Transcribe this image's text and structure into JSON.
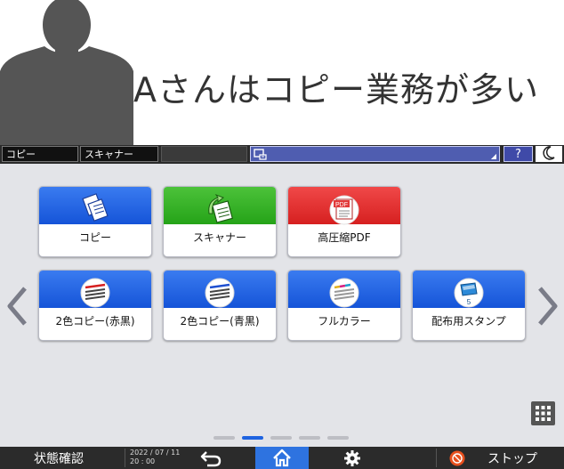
{
  "banner": {
    "headline": "Aさんはコピー業務が多い"
  },
  "topbar": {
    "tab1": "コピー",
    "tab2": "スキャナー",
    "help_label": "?"
  },
  "tiles": [
    {
      "label": "コピー"
    },
    {
      "label": "スキャナー"
    },
    {
      "label": "高圧縮PDF"
    },
    {
      "label": "2色コピー(赤黒)"
    },
    {
      "label": "2色コピー(青黒)"
    },
    {
      "label": "フルカラー"
    },
    {
      "label": "配布用スタンプ"
    }
  ],
  "pager": {
    "pages": 5,
    "active": 2
  },
  "bottombar": {
    "status_label": "状態確認",
    "date": "2022 / 07 / 11",
    "time": "20 : 00",
    "stop_label": "ストップ"
  },
  "colors": {
    "accent": "#1e63e0",
    "green": "#25a318",
    "red": "#d62020"
  },
  "icons": [
    "person-silhouette",
    "document-monitor-icon",
    "help-icon",
    "moon-icon",
    "copy-icon",
    "scanner-icon",
    "pdf-icon",
    "two-color-copy-icon",
    "full-color-icon",
    "stamp-icon",
    "chevron-left-icon",
    "chevron-right-icon",
    "apps-grid-icon",
    "back-icon",
    "home-icon",
    "gear-icon",
    "stop-icon"
  ]
}
